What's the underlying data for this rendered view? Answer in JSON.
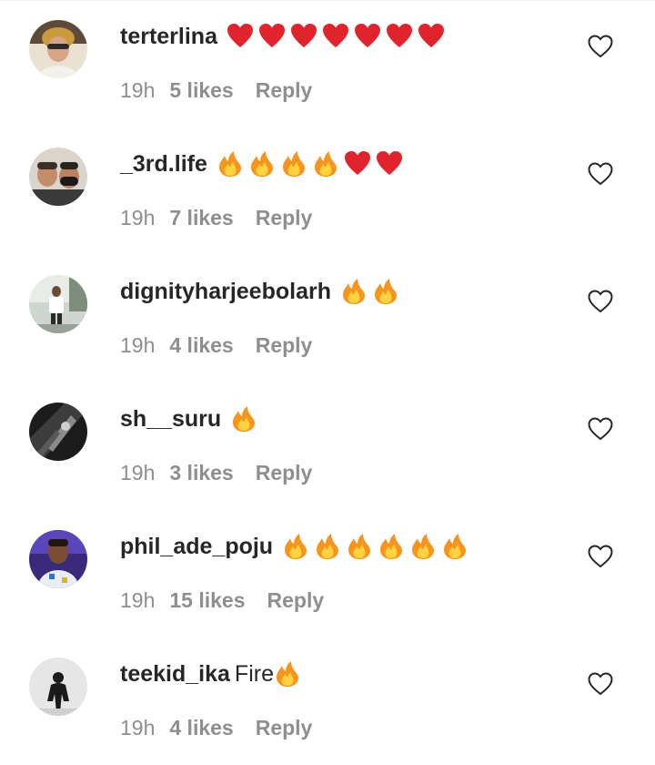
{
  "comments": [
    {
      "username": "terterlina",
      "text": "",
      "emojis": [
        "red-heart",
        "red-heart",
        "red-heart",
        "red-heart",
        "red-heart",
        "red-heart",
        "red-heart"
      ],
      "time": "19h",
      "likes": "5 likes",
      "reply": "Reply",
      "avatar": "avatar-person-yellow"
    },
    {
      "username": "_3rd.life",
      "text": "",
      "emojis": [
        "fire",
        "fire",
        "fire",
        "fire",
        "red-heart",
        "red-heart"
      ],
      "time": "19h",
      "likes": "7 likes",
      "reply": "Reply",
      "avatar": "avatar-two-people"
    },
    {
      "username": "dignityharjeebolarh",
      "text": "",
      "emojis": [
        "fire",
        "fire"
      ],
      "time": "19h",
      "likes": "4 likes",
      "reply": "Reply",
      "avatar": "avatar-person-standing"
    },
    {
      "username": "sh__suru",
      "text": "",
      "emojis": [
        "fire"
      ],
      "time": "19h",
      "likes": "3 likes",
      "reply": "Reply",
      "avatar": "avatar-dark-abstract"
    },
    {
      "username": "phil_ade_poju",
      "text": "",
      "emojis": [
        "fire",
        "fire",
        "fire",
        "fire",
        "fire",
        "fire"
      ],
      "time": "19h",
      "likes": "15 likes",
      "reply": "Reply",
      "avatar": "avatar-person-purple"
    },
    {
      "username": "teekid_ika",
      "text": "Fire",
      "emojis": [
        "fire"
      ],
      "time": "19h",
      "likes": "4 likes",
      "reply": "Reply",
      "avatar": "avatar-silhouette"
    }
  ],
  "colors": {
    "text_primary": "#262626",
    "text_secondary": "#8e8e8e",
    "heart_red": "#e0242e",
    "fire_orange": "#f7941d",
    "fire_yellow": "#ffd23f"
  },
  "icons": {
    "like": "heart-outline-icon",
    "red_heart": "red-heart-emoji",
    "fire": "fire-emoji"
  }
}
